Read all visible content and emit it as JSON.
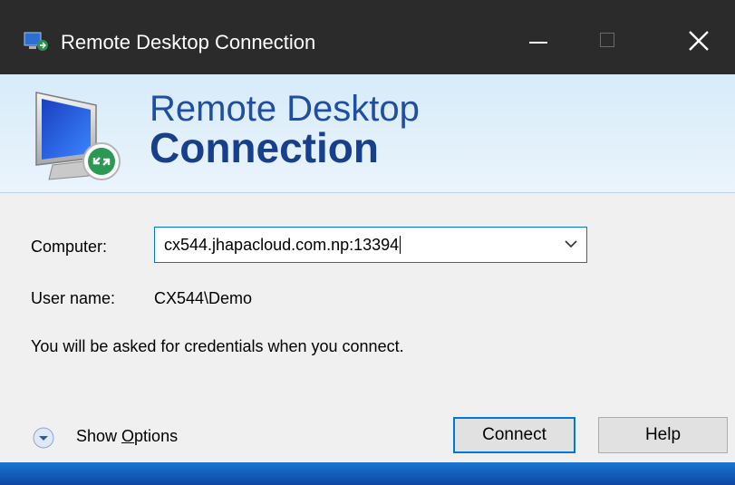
{
  "window": {
    "title": "Remote Desktop Connection",
    "controls": [
      "minimize",
      "maximize",
      "close"
    ]
  },
  "banner": {
    "line1": "Remote Desktop",
    "line2": "Connection"
  },
  "form": {
    "computer_label": "Computer:",
    "computer_value": "cx544.jhapacloud.com.np:13394",
    "username_label": "User name:",
    "username_value": "CX544\\Demo",
    "credentials_note": "You will be asked for credentials when you connect."
  },
  "footer": {
    "options_prefix": "Show ",
    "options_access_key": "O",
    "options_suffix": "ptions",
    "connect_label": "Connect",
    "help_label": "Help"
  },
  "colors": {
    "titlebar": "#2b2b2b",
    "accent": "#0078d7",
    "banner_text": "#1f4ea3"
  },
  "icons": {
    "app": "remote-desktop-app-icon",
    "banner": "remote-desktop-monitor-icon",
    "options": "chevron-circle-down-icon",
    "dropdown": "chevron-down-icon"
  }
}
